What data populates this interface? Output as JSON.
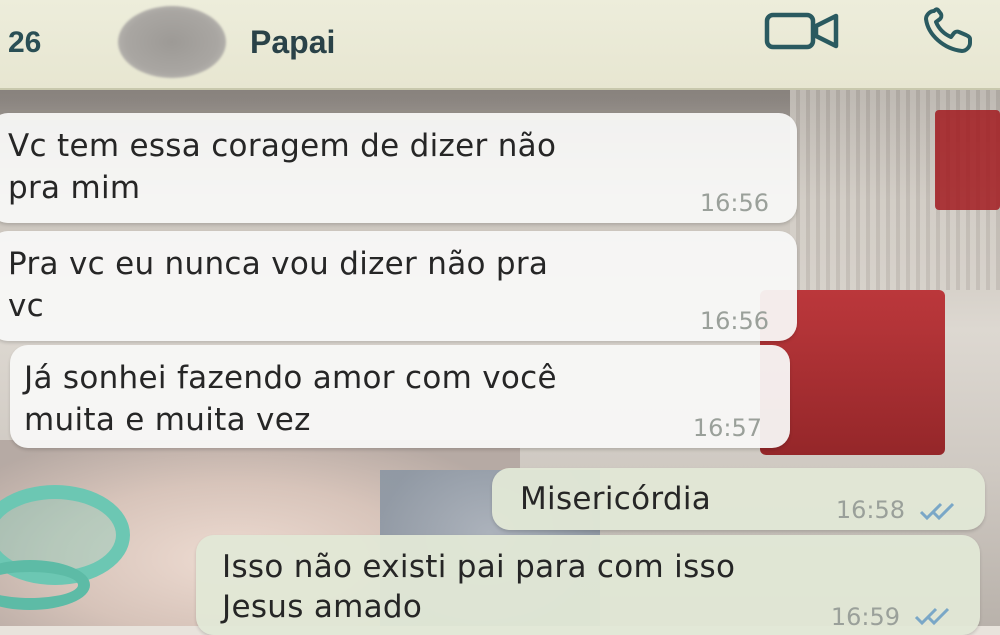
{
  "header": {
    "back_count": "26",
    "contact_name": "Papai",
    "video_icon": "video-camera-icon",
    "phone_icon": "phone-icon"
  },
  "messages": [
    {
      "direction": "incoming",
      "text": "Vc tem essa coragem de dizer não\npra mim",
      "time": "16:56"
    },
    {
      "direction": "incoming",
      "text": "Pra vc eu nunca vou dizer não pra\nvc",
      "time": "16:56"
    },
    {
      "direction": "incoming",
      "text": "Já sonhei fazendo amor com você\nmuita e muita vez",
      "time": "16:57"
    },
    {
      "direction": "outgoing",
      "text": "Misericórdia",
      "time": "16:58",
      "status": "read"
    },
    {
      "direction": "outgoing",
      "text": "Isso não existi pai para com isso\nJesus amado",
      "time": "16:59",
      "status": "read"
    }
  ],
  "colors": {
    "header_bg": "#ededdb",
    "header_icon": "#2a5a60",
    "read_ticks": "#7aa7c7",
    "incoming_bubble": "#f8f8f6",
    "outgoing_bubble": "#e2e8d6"
  }
}
